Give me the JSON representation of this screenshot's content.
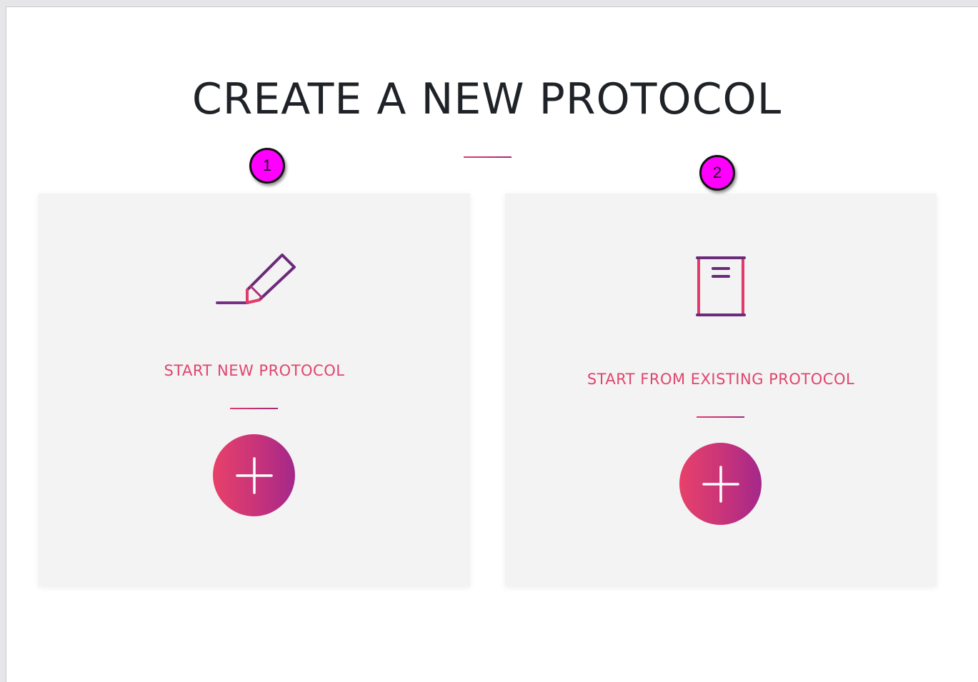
{
  "page": {
    "title": "CREATE A NEW PROTOCOL"
  },
  "cards": [
    {
      "label": "START NEW PROTOCOL",
      "icon": "pencil-icon",
      "button_icon": "plus-icon",
      "callout": "1"
    },
    {
      "label": "START FROM EXISTING PROTOCOL",
      "icon": "document-icon",
      "button_icon": "plus-icon",
      "callout": "2"
    }
  ],
  "colors": {
    "accent_pink": "#e0456d",
    "accent_purple": "#6b2a7a",
    "gradient_start": "#e7416a",
    "gradient_end": "#a4288a",
    "callout": "#ff00ff",
    "card_background": "#f3f3f4"
  }
}
